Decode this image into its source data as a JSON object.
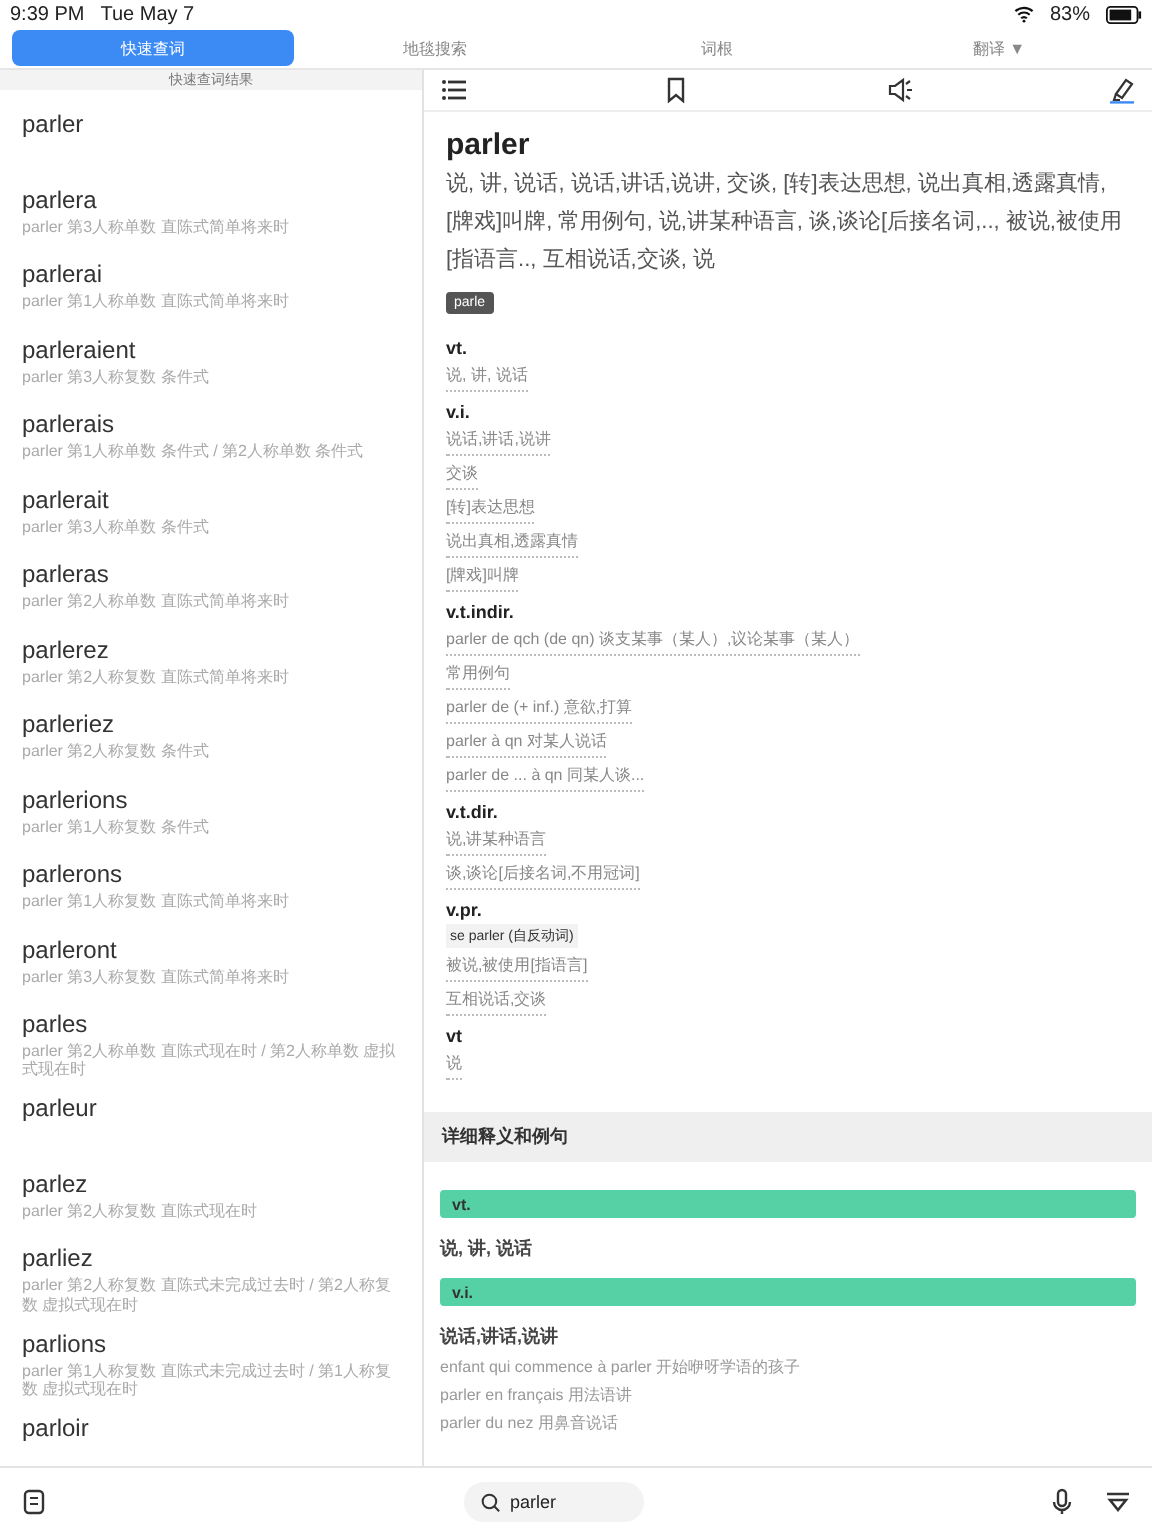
{
  "status_bar": {
    "time": "9:39 PM",
    "date": "Tue May 7",
    "battery": "83%"
  },
  "tabs": [
    {
      "label": "快速查词",
      "selected": true
    },
    {
      "label": "地毯搜索",
      "selected": false
    },
    {
      "label": "词根",
      "selected": false
    },
    {
      "label": "翻译 ▼",
      "selected": false
    }
  ],
  "results": {
    "header": "快速查词结果",
    "items": [
      {
        "word": "parler"
      },
      {
        "word": "parlera",
        "forms": "parler 第3人称单数  直陈式简单将来时"
      },
      {
        "word": "parlerai",
        "forms": "parler 第1人称单数  直陈式简单将来时"
      },
      {
        "word": "parleraient",
        "forms": "parler 第3人称复数  条件式"
      },
      {
        "word": "parlerais",
        "forms": "parler 第1人称单数  条件式 / 第2人称单数  条件式"
      },
      {
        "word": "parlerait",
        "forms": "parler 第3人称单数  条件式"
      },
      {
        "word": "parleras",
        "forms": "parler 第2人称单数  直陈式简单将来时"
      },
      {
        "word": "parlerez",
        "forms": "parler 第2人称复数  直陈式简单将来时"
      },
      {
        "word": "parleriez",
        "forms": "parler 第2人称复数  条件式"
      },
      {
        "word": "parlerions",
        "forms": "parler 第1人称复数  条件式"
      },
      {
        "word": "parlerons",
        "forms": "parler 第1人称复数  直陈式简单将来时"
      },
      {
        "word": "parleront",
        "forms": "parler 第3人称复数  直陈式简单将来时"
      },
      {
        "word": "parles",
        "forms": "parler 第2人称单数  直陈式现在时 / 第2人称单数  虚拟式现在时"
      },
      {
        "word": "parleur"
      },
      {
        "word": "parlez",
        "forms": "parler 第2人称复数  直陈式现在时"
      },
      {
        "word": "parliez",
        "forms": "parler 第2人称复数  直陈式未完成过去时 / 第2人称复数  虚拟式现在时"
      },
      {
        "word": "parlions",
        "forms": "parler 第1人称复数  直陈式未完成过去时 / 第1人称复数  虚拟式现在时"
      },
      {
        "word": "parloir"
      }
    ]
  },
  "entry": {
    "headword": "parler",
    "summary": "说, 讲, 说话, 说话,讲话,说讲, 交谈, [转]表达思想, 说出真相,透露真情, [牌戏]叫牌, 常用例句, 说,讲某种语言, 谈,谈论[后接名词,.., 被说,被使用[指语言.., 互相说话,交谈, 说",
    "tag": "parle",
    "sections": [
      {
        "pos": "vt.",
        "items": [
          {
            "kind": "sense",
            "text": "说, 讲, 说话"
          }
        ]
      },
      {
        "pos": "v.i.",
        "items": [
          {
            "kind": "sense",
            "text": "说话,讲话,说讲"
          },
          {
            "kind": "sense",
            "text": "交谈"
          },
          {
            "kind": "sense",
            "text": "[转]表达思想"
          },
          {
            "kind": "sense",
            "text": "说出真相,透露真情"
          },
          {
            "kind": "sense",
            "text": "[牌戏]叫牌"
          }
        ]
      },
      {
        "pos": "v.t.indir.",
        "items": [
          {
            "kind": "sense",
            "text": "parler de qch (de qn) 谈支某事（某人）,议论某事（某人）"
          },
          {
            "kind": "sense",
            "text": "常用例句"
          },
          {
            "kind": "sense",
            "text": "parler de (+ inf.) 意欲,打算"
          },
          {
            "kind": "sense",
            "text": "parler à qn 对某人说话"
          },
          {
            "kind": "sense",
            "text": "parler de ... à qn 同某人谈..."
          }
        ]
      },
      {
        "pos": "v.t.dir.",
        "items": [
          {
            "kind": "sense",
            "text": "说,讲某种语言"
          },
          {
            "kind": "sense",
            "text": "谈,谈论[后接名词,不用冠词]"
          }
        ]
      },
      {
        "pos": "v.pr.",
        "items": [
          {
            "kind": "label",
            "text": "se parler (自反动词)"
          },
          {
            "kind": "sense",
            "text": "被说,被使用[指语言]"
          },
          {
            "kind": "sense",
            "text": "互相说话,交谈"
          }
        ]
      },
      {
        "pos": "vt",
        "items": [
          {
            "kind": "sense",
            "text": "说"
          }
        ]
      }
    ]
  },
  "details": {
    "header": "详细释义和例句",
    "groups": [
      {
        "pos": "vt.",
        "meaning": "说, 讲, 说话"
      },
      {
        "pos": "v.i.",
        "meaning": "说话,讲话,说讲",
        "examples": [
          "enfant qui commence à parler 开始咿呀学语的孩子",
          "parler en français 用法语讲",
          "parler du nez 用鼻音说话"
        ]
      }
    ]
  },
  "search": {
    "value": "parler"
  }
}
